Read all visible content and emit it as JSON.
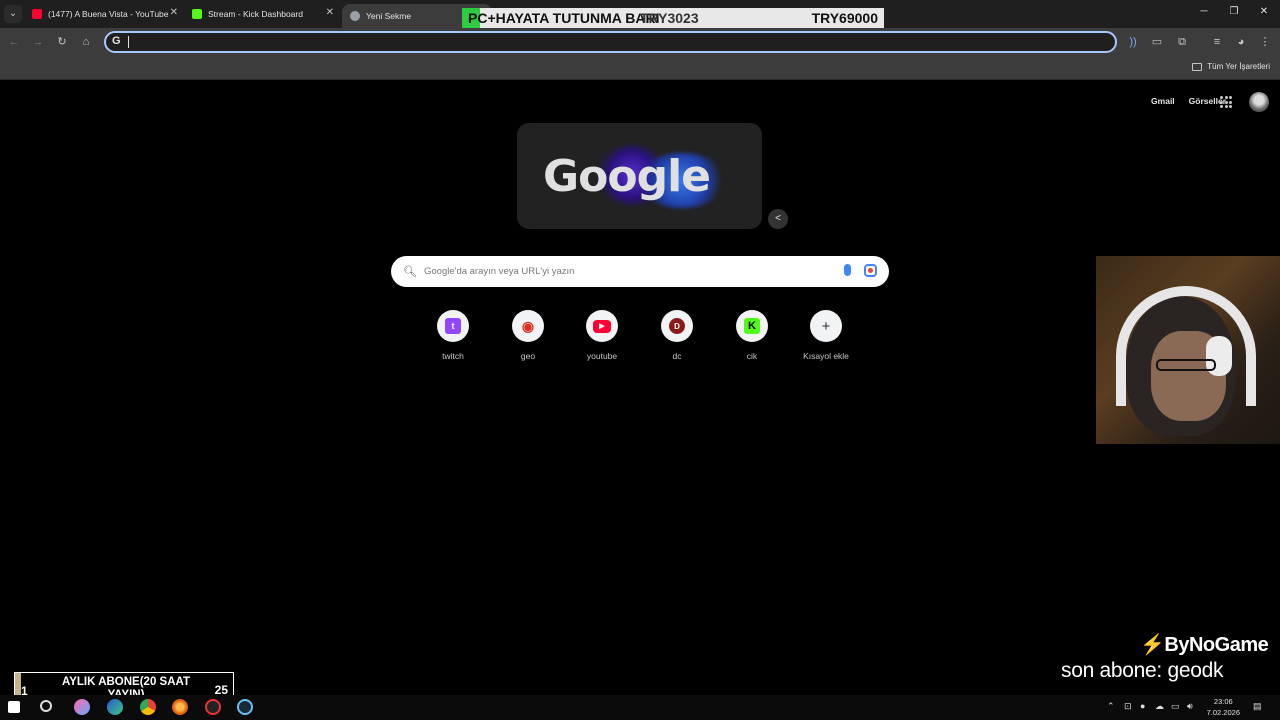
{
  "browser": {
    "tabs": [
      {
        "title": "(1477) A Buena Vista - YouTube",
        "favicon": "youtube-icon",
        "color": "#ff0033"
      },
      {
        "title": "Stream - Kick Dashboard",
        "favicon": "kick-icon",
        "color": "#53fc18"
      },
      {
        "title": "Yeni Sekme",
        "favicon": "chrome-icon",
        "color": "#9aa0a6"
      }
    ],
    "omnibox_value": "",
    "bookmarks_all_label": "Tüm Yer İşaretleri"
  },
  "donation_banner": {
    "left_text": "PC+HAYATA TUTUNMA BARI",
    "middle_text": "TRY3023",
    "right_text": "TRY69000",
    "accent": "#2ecc40"
  },
  "ntp": {
    "header_links": [
      "Gmail",
      "Görseller"
    ],
    "doodle_text": "Google",
    "search_placeholder": "Google'da arayın veya URL'yi yazın",
    "shortcuts": [
      {
        "label": "twitch",
        "icon": "twitch-icon",
        "color": "#9146ff",
        "glyph": "t"
      },
      {
        "label": "geo",
        "icon": "map-pin-icon",
        "color": "#d93025",
        "glyph": "◉"
      },
      {
        "label": "youtube",
        "icon": "youtube-icon",
        "color": "#ff0033",
        "glyph": "▶"
      },
      {
        "label": "dc",
        "icon": "dc-icon",
        "color": "#8b1a1a",
        "glyph": "D"
      },
      {
        "label": "cik",
        "icon": "kick-icon",
        "color": "#53fc18",
        "glyph": "K"
      },
      {
        "label": "Kısayol ekle",
        "icon": "add-icon",
        "color": "#f1f3f4",
        "glyph": "+"
      }
    ]
  },
  "overlay": {
    "sponsor": "ByNoGame",
    "last_subscriber": "son abone: geodk",
    "sub_goal": {
      "title": "AYLIK ABONE(20 SAAT YAYIN)",
      "current": "1",
      "target": "25",
      "progress": 0.04
    }
  },
  "taskbar": {
    "time": "23:06",
    "date": "7.02.2026"
  }
}
